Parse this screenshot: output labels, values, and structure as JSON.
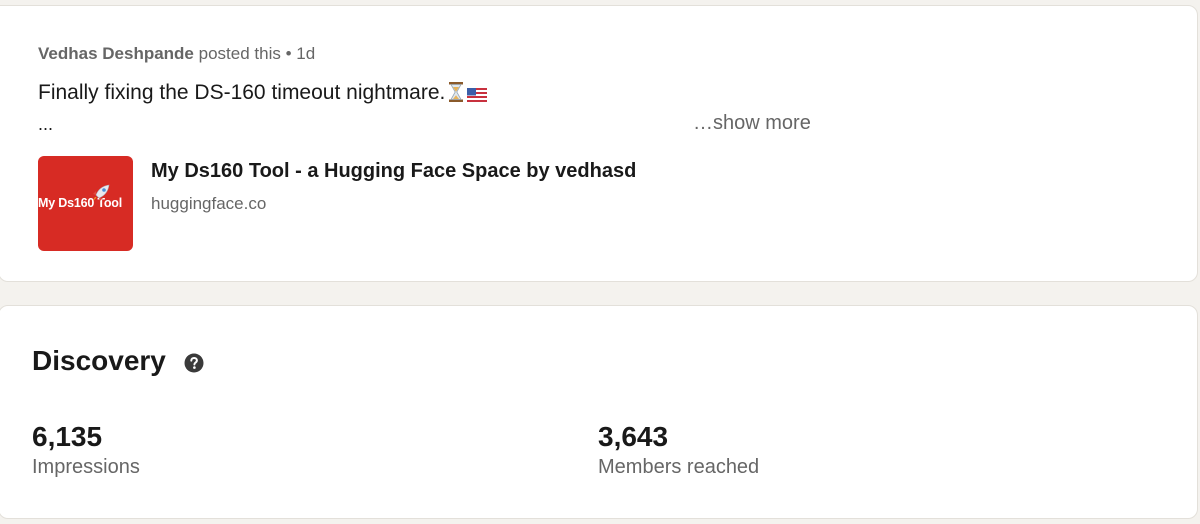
{
  "post": {
    "author": "Vedhas Deshpande",
    "action": "posted this",
    "separator": "•",
    "time": "1d",
    "text": "Finally fixing the DS-160 timeout nightmare.",
    "emoji_1": "hourglass-icon",
    "emoji_2": "us-flag-icon",
    "ellipsis": "...",
    "show_more": "…show more"
  },
  "link_preview": {
    "thumbnail_text": "My Ds160 Tool",
    "thumbnail_color": "#d72b24",
    "title": "My Ds160 Tool - a Hugging Face Space by vedhasd",
    "domain": "huggingface.co"
  },
  "discovery": {
    "title": "Discovery",
    "help_icon": "question-circle-icon",
    "metrics": [
      {
        "value": "6,135",
        "label": "Impressions"
      },
      {
        "value": "3,643",
        "label": "Members reached"
      }
    ]
  }
}
